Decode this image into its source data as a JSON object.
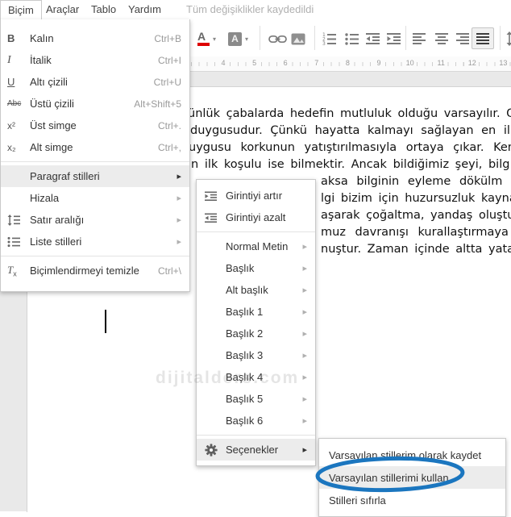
{
  "menubar": {
    "items": [
      {
        "label": "Biçim"
      },
      {
        "label": "Araçlar"
      },
      {
        "label": "Tablo"
      },
      {
        "label": "Yardım"
      }
    ],
    "status": "Tüm değişiklikler kaydedildi"
  },
  "glyphs": {
    "bold": "B",
    "italic": "I",
    "underline": "U",
    "strikethrough": "Abc",
    "superscript": "x²",
    "subscript": "x₂",
    "clear_t": "T",
    "clear_x": "x",
    "text_color": "A",
    "highlight": "A",
    "caret": "▾",
    "arrow": "▸"
  },
  "ruler": {
    "numbers": [
      "4",
      "5",
      "6",
      "7",
      "8",
      "9",
      "10",
      "11",
      "12",
      "13"
    ]
  },
  "format_menu": {
    "items": [
      {
        "label": "Kalın",
        "shortcut": "Ctrl+B"
      },
      {
        "label": "İtalik",
        "shortcut": "Ctrl+I"
      },
      {
        "label": "Altı çizili",
        "shortcut": "Ctrl+U"
      },
      {
        "label": "Üstü çizili",
        "shortcut": "Alt+Shift+5"
      },
      {
        "label": "Üst simge",
        "shortcut": "Ctrl+."
      },
      {
        "label": "Alt simge",
        "shortcut": "Ctrl+,"
      },
      {
        "label": "Paragraf stilleri"
      },
      {
        "label": "Hizala"
      },
      {
        "label": "Satır aralığı"
      },
      {
        "label": "Liste stilleri"
      },
      {
        "label": "Biçimlendirmeyi temizle",
        "shortcut": "Ctrl+\\"
      }
    ]
  },
  "paragraph_styles_menu": {
    "items": [
      {
        "label": "Girintiyi artır"
      },
      {
        "label": "Girintiyi azalt"
      },
      {
        "label": "Normal Metin"
      },
      {
        "label": "Başlık"
      },
      {
        "label": "Alt başlık"
      },
      {
        "label": "Başlık 1"
      },
      {
        "label": "Başlık 2"
      },
      {
        "label": "Başlık 3"
      },
      {
        "label": "Başlık 4"
      },
      {
        "label": "Başlık 5"
      },
      {
        "label": "Başlık 6"
      },
      {
        "label": "Seçenekler"
      }
    ]
  },
  "options_menu": {
    "items": [
      {
        "label": "Varsayılan stillerim olarak kaydet"
      },
      {
        "label": "Varsayılan stillerimi kullan"
      },
      {
        "label": "Stilleri sıfırla"
      }
    ]
  },
  "document": {
    "lines": [
      "ünlük çabalarda hedefin mutluluk olduğu varsayılır. Oys",
      "duygusudur. Çünkü hayatta kalmayı sağlayan en ilke",
      "uygusu korkunun yatıştırılmasıyla ortaya çıkar. Ken",
      "in ilk koşulu ise bilmektir. Ancak bildiğimiz şeyi, bilg",
      "aksa bilginin eyleme dökülm",
      "lgi bizim için huzursuzluk kaynağ",
      "aşarak çoğaltma, yandaş oluşturm",
      "muz davranışı kurallaştırmaya g",
      "nuştur. Zaman içinde altta yatan b"
    ],
    "watermark": "dijitalders.com"
  },
  "colors": {
    "annotation_blue": "#1b76bf",
    "text_color_red": "#dd0000"
  }
}
